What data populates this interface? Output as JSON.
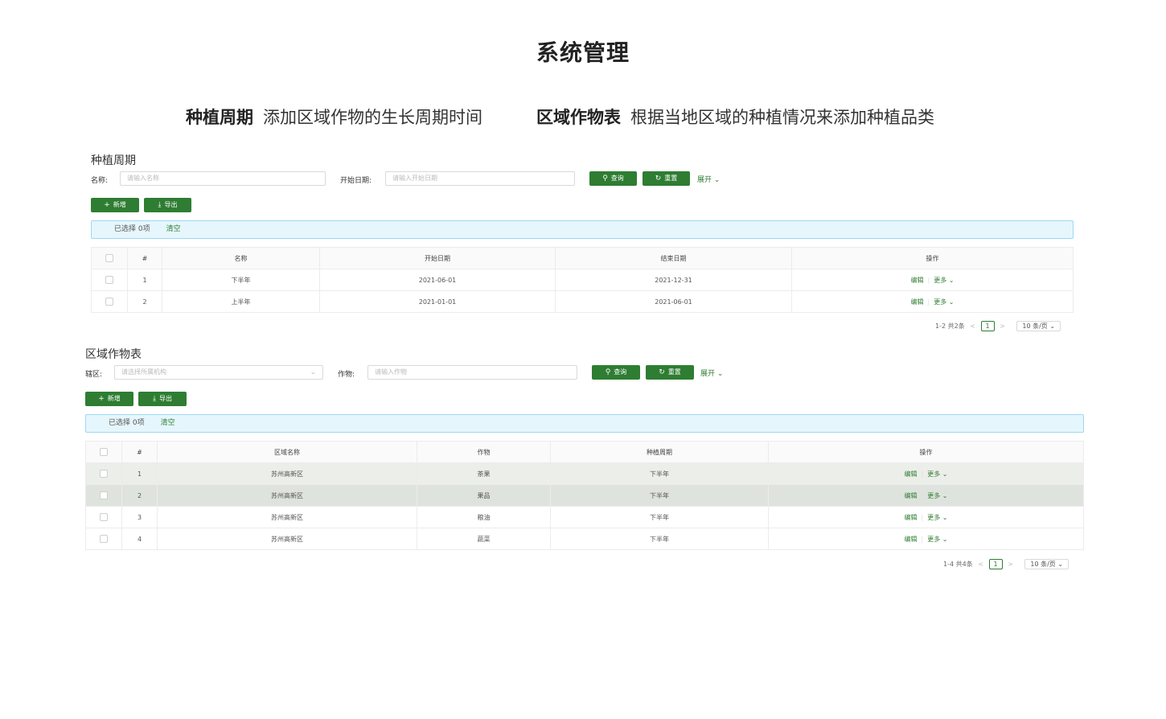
{
  "page": {
    "title": "系统管理",
    "features": [
      {
        "name": "种植周期",
        "desc": "添加区域作物的生长周期时间"
      },
      {
        "name": "区域作物表",
        "desc": "根据当地区域的种植情况来添加种植品类"
      }
    ]
  },
  "cycle": {
    "title": "种植周期",
    "filters": {
      "name_label": "名称:",
      "name_placeholder": "请输入名称",
      "date_label": "开始日期:",
      "date_placeholder": "请输入开始日期"
    },
    "search_label": "查询",
    "reset_label": "重置",
    "expand_label": "展开",
    "add_label": "新增",
    "export_label": "导出",
    "selected_text": "已选择 0项",
    "clear_label": "清空",
    "columns": [
      "#",
      "名称",
      "开始日期",
      "结束日期",
      "操作"
    ],
    "rows": [
      {
        "no": "1",
        "name": "下半年",
        "start": "2021-06-01",
        "end": "2021-12-31"
      },
      {
        "no": "2",
        "name": "上半年",
        "start": "2021-01-01",
        "end": "2021-06-01"
      }
    ],
    "edit_label": "编辑",
    "more_label": "更多",
    "pager": {
      "total": "1-2 共2条",
      "page": "1",
      "size": "10 条/页"
    }
  },
  "crop": {
    "title": "区域作物表",
    "filters": {
      "zone_label": "辖区:",
      "zone_placeholder": "请选择所属机构",
      "crop_label": "作物:",
      "crop_placeholder": "请输入作物"
    },
    "search_label": "查询",
    "reset_label": "重置",
    "expand_label": "展开",
    "add_label": "新增",
    "export_label": "导出",
    "selected_text": "已选择 0项",
    "clear_label": "清空",
    "columns": [
      "#",
      "区域名称",
      "作物",
      "种植周期",
      "操作"
    ],
    "rows": [
      {
        "no": "1",
        "area": "苏州高新区",
        "crop": "茶果",
        "cycle": "下半年"
      },
      {
        "no": "2",
        "area": "苏州高新区",
        "crop": "果品",
        "cycle": "下半年"
      },
      {
        "no": "3",
        "area": "苏州高新区",
        "crop": "粮油",
        "cycle": "下半年"
      },
      {
        "no": "4",
        "area": "苏州高新区",
        "crop": "蔬菜",
        "cycle": "下半年"
      }
    ],
    "edit_label": "编辑",
    "more_label": "更多",
    "pager": {
      "total": "1-4 共4条",
      "page": "1",
      "size": "10 条/页"
    }
  }
}
